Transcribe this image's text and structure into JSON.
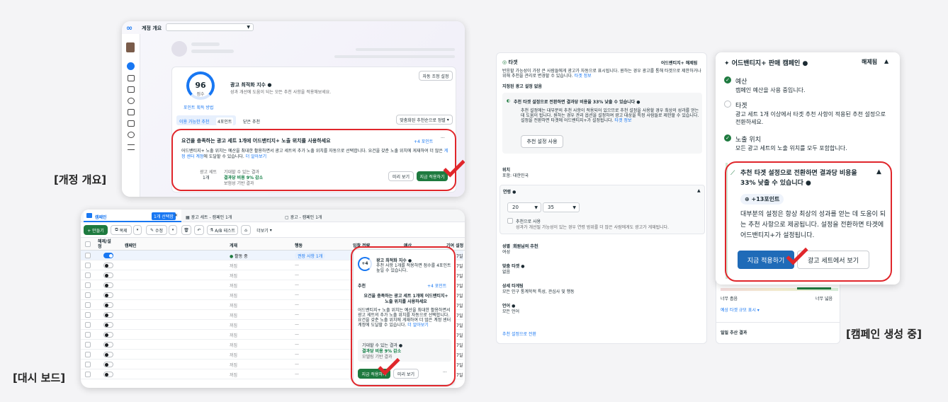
{
  "captions": {
    "overview": "[개정 개요]",
    "dashboard": "[대시 보드]",
    "campaign": "[캠페인 생성 중]"
  },
  "overview": {
    "account_label": "계정 개요",
    "score": "96",
    "score_unit": "점수",
    "score_link": "포인트 획득 방법",
    "auto_apply_btn": "자동 조정 설정",
    "opt_title": "광고 최적화 지수",
    "opt_desc": "성과 개선에 도움이 되는 모든 추천 사항을 적용해보세요.",
    "tab_available": "이용 가능한 추천",
    "tab_count": "4포인트",
    "tab_closed": "닫은 추천",
    "sort": "맞춤화된 추천순으로 정렬",
    "rec_title": "요건을 충족하는 광고 세트 1개에 어드밴티지+ 노출 위치를 사용하세요",
    "rec_points": "+4 포인트",
    "rec_desc": "어드밴티지+ 노출 위치는 예산을 최대한 활용하면서 광고 세트의 추가 노출 위치를 자동으로 선택합니다. 요건을 갖춘 노출 위치에 게재하여 더 많은",
    "rec_desc_link": "계정 센터 계정",
    "rec_desc2": "에 도달할 수 있습니다.",
    "rec_more": "더 알아보기",
    "meta_col1": "광고 세트",
    "meta_val1": "1개",
    "meta_col2": "기대할 수 있는 결과",
    "meta_val2": "결과당 비용 9% 감소",
    "meta_sub2": "보험성 기반 결과",
    "preview_btn": "미리 보기",
    "apply_btn": "지금 적용하기"
  },
  "dashboard": {
    "tab_campaign": "캠페인",
    "badge": "1개 선택함",
    "tab_adset": "광고 세트 - 캠페인 1개",
    "tab_ad": "광고 - 캠페인 1개",
    "create_btn": "+ 만들기",
    "copy_btn": "복제",
    "edit_btn": "수정",
    "ab_btn": "A/B 테스트",
    "more_btn": "더보기",
    "col_onoff": "해제/설정",
    "col_campaign": "캠페인",
    "col_delivery": "게재",
    "col_action": "행동",
    "col_bid": "입찰 전략",
    "col_budget": "예산",
    "col_attr": "기여 설정",
    "status_active": "활동 중",
    "status_off": "꺼짐",
    "rec_chip": "권장 사항 1개",
    "dash": "—",
    "panel_score": "+4",
    "panel_title": "광고 최적화 지수",
    "panel_desc": "추천 사항 1개를 적용하면 점수를 4포인트 높일 수 있습니다.",
    "panel_rec": "추천",
    "panel_points": "+4 포인트",
    "panel_rec_title": "요건을 충족하는 광고 세트 1개에 어드밴티지+ 노출 위치를 사용하세요",
    "panel_rec_desc": "어드밴티지+ 노출 위치는 예산을 최대한 활용하면서 광고 세트의 추가 노출 위치를 자동으로 선택합니다. 요건을 갖춘 노출 위치에 게재하여 더 많은 계정 센터 계정에 도달할 수 있습니다.",
    "panel_more": "더 알아보기",
    "panel_expect": "기대할 수 있는 결과",
    "panel_expect_val": "결과당 비용 9% 감소",
    "panel_expect_sub": "모델링 기반 결과",
    "apply_btn": "지금 적용하기",
    "preview_btn": "미리 보기",
    "row_value": "7일"
  },
  "target": {
    "title": "타겟",
    "adv_chip": "어드밴티지+ 해제됨",
    "intro": "반응할 가능성이 가장 큰 사람들에게 광고가 자동으로 표시됩니다. 원하는 경우 광고를 통해 타겟으로 제한하거나 위해 추천을 관리로 변경할 수 있습니다.",
    "intro_link": "타겟 정보",
    "saved": "지정된 광고 설정 없음",
    "tip_title": "추천 타겟 설정으로 전환하면 결과당 비용을 33% 낮출 수 있습니다",
    "tip_body": "추천 설정에는 대부분의 추천 사항이 적용되어 있으므로 추천 설정을 사용할 경우 최상의 성과를 얻는 데 도움이 됩니다. 원하는 경우 관리 옵션을 설정하여 광고 대상을 특정 사람들로 제한할 수 있습니다. 설정을 전환하면 타겟에 어드밴티지+가 설정됩니다.",
    "tip_link": "타겟 정보",
    "use_rec_btn": "추천 설정 사용",
    "loc_label": "위치",
    "loc_val": "포함: 대한민국",
    "age_label": "연령",
    "age_min": "20",
    "age_max": "35",
    "age_rec": "추천으로 사용",
    "age_rec_sub": "성과가 개선될 가능성이 있는 경우 연령 범위를 더 많은 사람에게도 광고가 게재됩니다.",
    "gender_label": "성별",
    "gender_chip": "회원님의 추천",
    "gender_val": "여성",
    "custom_label": "맞춤 타겟",
    "custom_val": "없음",
    "detail_label": "상세 타게팅",
    "detail_val": "모든 인구 통계학적 특성, 관심사 및 행동",
    "lang_label": "언어",
    "lang_val": "모든 언어",
    "switch_link": "추천 설정으로 전환"
  },
  "sales": {
    "title": "어드밴티지+ 판매 캠페인",
    "status": "해제됨",
    "budget_label": "예산",
    "budget_desc": "캠페인 예산을 사용 중입니다.",
    "target_label": "타겟",
    "target_desc": "광고 세트 1개 이상에서 타겟 추천 사항이 적용된 추천 설정으로 전환하세요.",
    "placement_label": "노출 위치",
    "placement_desc": "모든 광고 세트의 노출 위치를 모두 포함합니다.",
    "rec_title": "추천 타겟 설정으로 전환하면 결과당 비용을 33% 낮출 수 있습니다",
    "rec_points": "+13포인트",
    "rec_body": "대부분의 설정은 항상 최상의 성과를 얻는 데 도움이 되는 추천 사항으로 제공됩니다. 설정을 전환하면 타겟에 어드밴티지+가 설정됩니다.",
    "apply_btn": "지금 적용하기",
    "view_btn": "광고 세트에서 보기",
    "reach_narrow": "너무 좁음",
    "reach_wide": "너무 넓음",
    "reach_link": "예상 타겟 규모 표시",
    "daily_title": "일일 추산 결과"
  },
  "colors": {
    "accent_red": "#e0262b",
    "meta_blue": "#1877f2",
    "fb_green": "#1e7a3f",
    "apply_blue": "#1f6bb8"
  }
}
